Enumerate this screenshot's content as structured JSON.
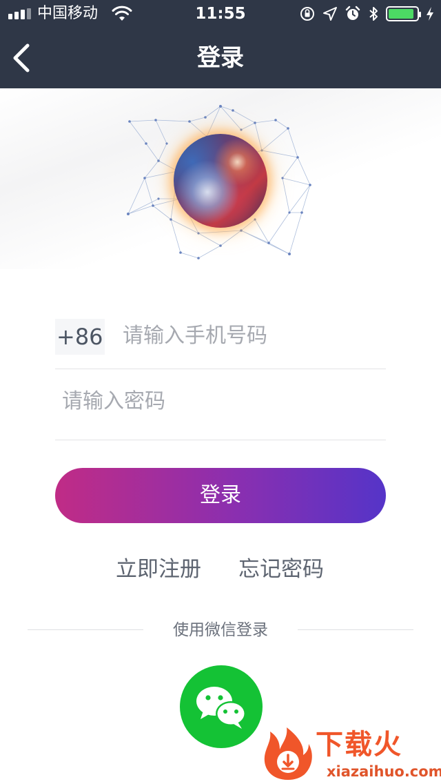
{
  "status_bar": {
    "carrier": "中国移动",
    "time": "11:55",
    "battery_level": 0.9,
    "battery_color": "#4cd964"
  },
  "nav": {
    "title": "登录",
    "back_icon": "chevron-left-icon"
  },
  "hero": {
    "image": "planet-constellation"
  },
  "form": {
    "country_code": "+86",
    "phone_placeholder": "请输入手机号码",
    "password_placeholder": "请输入密码",
    "login_label": "登录"
  },
  "links": {
    "register": "立即注册",
    "forgot": "忘记密码"
  },
  "social": {
    "divider_text": "使用微信登录",
    "wechat_icon": "wechat-icon",
    "wechat_color": "#14c235"
  },
  "watermark": {
    "title": "下载火",
    "url": "xiazaihuo.com"
  }
}
